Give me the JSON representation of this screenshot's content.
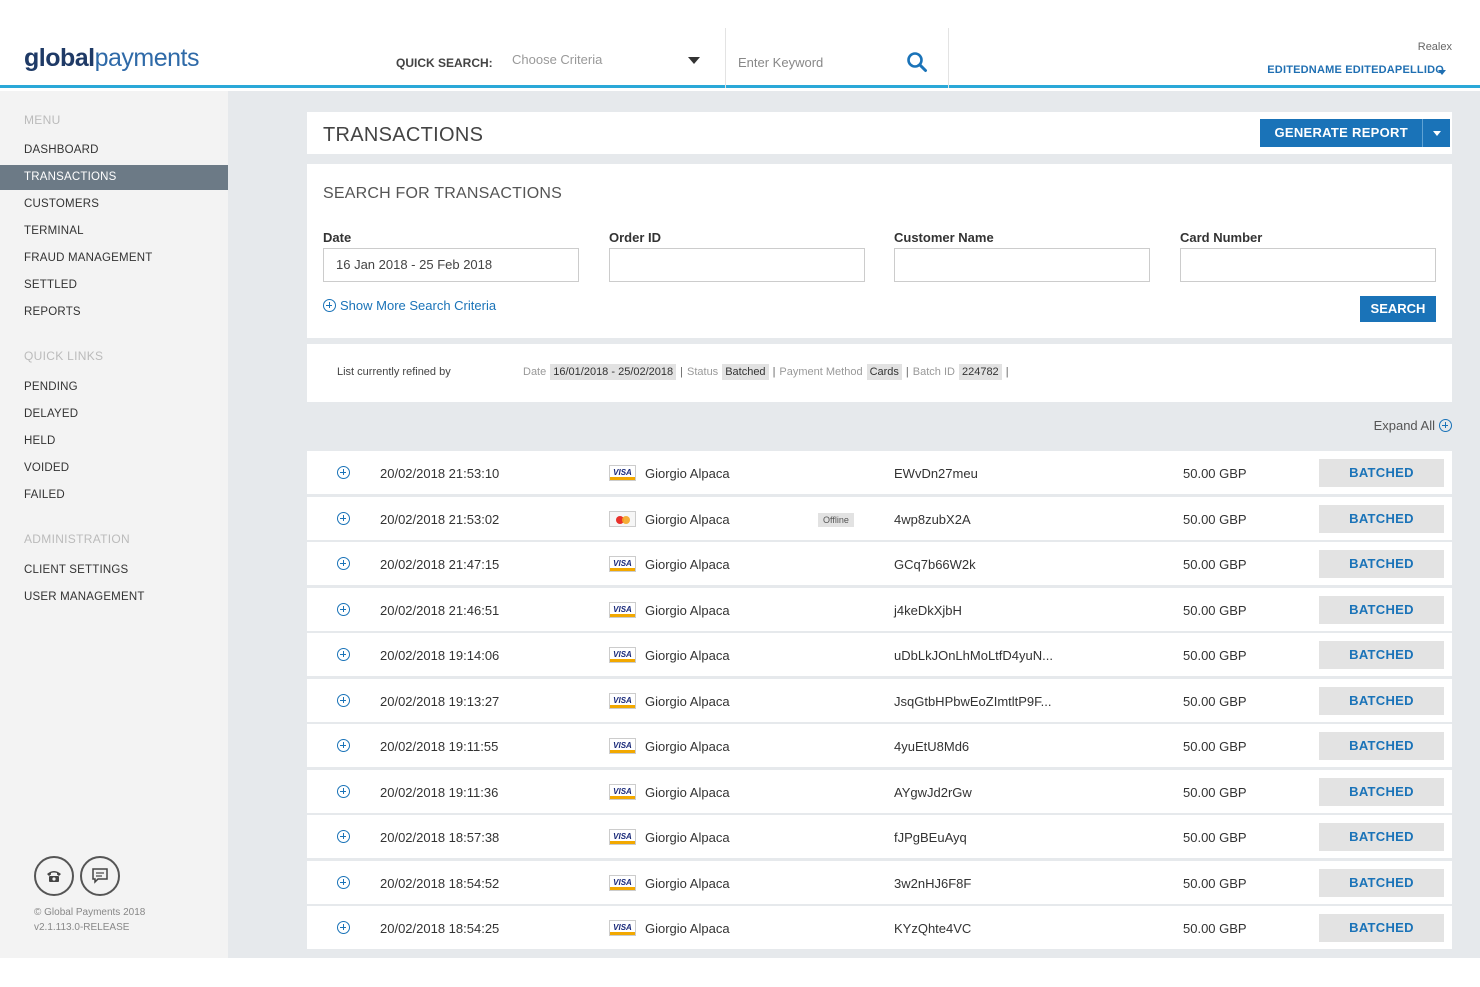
{
  "brand": {
    "bold": "global",
    "light": "payments"
  },
  "header": {
    "quick_search_label": "QUICK SEARCH:",
    "criteria_placeholder": "Choose Criteria",
    "keyword_placeholder": "Enter Keyword",
    "merchant": "Realex",
    "user_name": "EDITEDNAME EDITEDAPELLIDO"
  },
  "sidebar": {
    "menu_heading": "MENU",
    "menu": [
      "DASHBOARD",
      "TRANSACTIONS",
      "CUSTOMERS",
      "TERMINAL",
      "FRAUD MANAGEMENT",
      "SETTLED",
      "REPORTS"
    ],
    "active": "TRANSACTIONS",
    "quick_links_heading": "QUICK LINKS",
    "quick_links": [
      "PENDING",
      "DELAYED",
      "HELD",
      "VOIDED",
      "FAILED"
    ],
    "admin_heading": "ADMINISTRATION",
    "admin": [
      "CLIENT SETTINGS",
      "USER MANAGEMENT"
    ],
    "footer": {
      "copyright": "© Global Payments 2018",
      "version": "v2.1.113.0-RELEASE"
    }
  },
  "page": {
    "title": "TRANSACTIONS",
    "generate_report": "GENERATE REPORT"
  },
  "search": {
    "title": "SEARCH FOR TRANSACTIONS",
    "fields": [
      {
        "label": "Date",
        "value": "16 Jan 2018 - 25 Feb 2018"
      },
      {
        "label": "Order ID",
        "value": ""
      },
      {
        "label": "Customer Name",
        "value": ""
      },
      {
        "label": "Card Number",
        "value": ""
      }
    ],
    "more_criteria": "Show More Search Criteria",
    "search_button": "SEARCH"
  },
  "refine": {
    "label": "List currently refined by",
    "filters": [
      {
        "key": "Date",
        "value": "16/01/2018 - 25/02/2018"
      },
      {
        "key": "Status",
        "value": "Batched"
      },
      {
        "key": "Payment Method",
        "value": "Cards"
      },
      {
        "key": "Batch ID",
        "value": "224782"
      }
    ]
  },
  "expand_all": "Expand All",
  "transactions": [
    {
      "datetime": "20/02/2018 21:53:10",
      "card": "visa",
      "customer": "Giorgio Alpaca",
      "tag": "",
      "order_id": "EWvDn27meu",
      "amount": "50.00 GBP",
      "status": "BATCHED"
    },
    {
      "datetime": "20/02/2018 21:53:02",
      "card": "mastercard",
      "customer": "Giorgio Alpaca",
      "tag": "Offline",
      "order_id": "4wp8zubX2A",
      "amount": "50.00 GBP",
      "status": "BATCHED"
    },
    {
      "datetime": "20/02/2018 21:47:15",
      "card": "visa",
      "customer": "Giorgio Alpaca",
      "tag": "",
      "order_id": "GCq7b66W2k",
      "amount": "50.00 GBP",
      "status": "BATCHED"
    },
    {
      "datetime": "20/02/2018 21:46:51",
      "card": "visa",
      "customer": "Giorgio Alpaca",
      "tag": "",
      "order_id": "j4keDkXjbH",
      "amount": "50.00 GBP",
      "status": "BATCHED"
    },
    {
      "datetime": "20/02/2018 19:14:06",
      "card": "visa",
      "customer": "Giorgio Alpaca",
      "tag": "",
      "order_id": "uDbLkJOnLhMoLtfD4yuN...",
      "amount": "50.00 GBP",
      "status": "BATCHED"
    },
    {
      "datetime": "20/02/2018 19:13:27",
      "card": "visa",
      "customer": "Giorgio Alpaca",
      "tag": "",
      "order_id": "JsqGtbHPbwEoZImtltP9F...",
      "amount": "50.00 GBP",
      "status": "BATCHED"
    },
    {
      "datetime": "20/02/2018 19:11:55",
      "card": "visa",
      "customer": "Giorgio Alpaca",
      "tag": "",
      "order_id": "4yuEtU8Md6",
      "amount": "50.00 GBP",
      "status": "BATCHED"
    },
    {
      "datetime": "20/02/2018 19:11:36",
      "card": "visa",
      "customer": "Giorgio Alpaca",
      "tag": "",
      "order_id": "AYgwJd2rGw",
      "amount": "50.00 GBP",
      "status": "BATCHED"
    },
    {
      "datetime": "20/02/2018 18:57:38",
      "card": "visa",
      "customer": "Giorgio Alpaca",
      "tag": "",
      "order_id": "fJPgBEuAyq",
      "amount": "50.00 GBP",
      "status": "BATCHED"
    },
    {
      "datetime": "20/02/2018 18:54:52",
      "card": "visa",
      "customer": "Giorgio Alpaca",
      "tag": "",
      "order_id": "3w2nHJ6F8F",
      "amount": "50.00 GBP",
      "status": "BATCHED"
    },
    {
      "datetime": "20/02/2018 18:54:25",
      "card": "visa",
      "customer": "Giorgio Alpaca",
      "tag": "",
      "order_id": "KYzQhte4VC",
      "amount": "50.00 GBP",
      "status": "BATCHED"
    }
  ],
  "colors": {
    "accent": "#1a73b8",
    "header_rule": "#2aa8d8",
    "sidebar_active": "#6c7a86"
  }
}
